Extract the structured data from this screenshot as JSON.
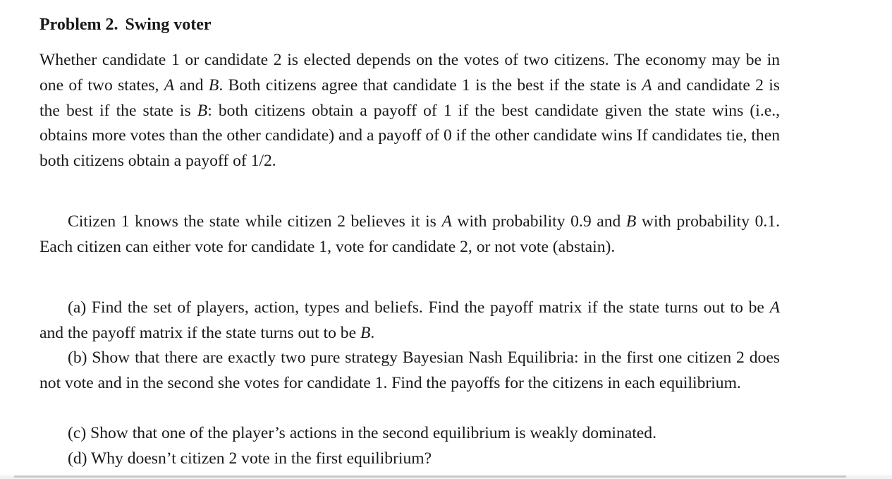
{
  "problem": {
    "label": "Problem 2.",
    "title": "Swing voter"
  },
  "paragraph1": {
    "s1": "Whether candidate 1 or candidate 2 is elected depends on the votes of two citizens. The economy may be in one of two states, ",
    "stateA": "A",
    "s2": " and ",
    "stateB": "B",
    "s3": ". Both citizens agree that candidate 1 is the best if the state is ",
    "stateA2": "A",
    "s4": " and candidate 2 is the best if the state is ",
    "stateB2": "B",
    "s5": ": both citizens obtain a payoff of 1 if the best candidate given the state wins (i.e., obtains more votes than the other candidate) and a payoff of 0 if the other candidate wins If candidates tie, then both citizens obtain a payoff of 1/2."
  },
  "paragraph2": {
    "s1": "Citizen 1 knows the state while citizen 2 believes it is ",
    "stateA": "A",
    "s2": " with probability 0.9 and ",
    "stateB": "B",
    "s3": " with probability 0.1. Each citizen can either vote for candidate 1, vote for candidate 2, or not vote (abstain)."
  },
  "questions": {
    "a": {
      "s1": "(a) Find the set of players, action, types and beliefs. Find the payoff matrix if the state turns out to be ",
      "stateA": "A",
      "s2": " and the payoff matrix if the state turns out to be ",
      "stateB": "B",
      "s3": "."
    },
    "b": "(b) Show that there are exactly two pure strategy Bayesian Nash Equilibria: in the first one citizen 2 does not vote and in the second she votes for candidate 1. Find the payoffs for the citizens in each equilibrium.",
    "c": "(c) Show that one of the player’s actions in the second equilibrium is weakly dominated.",
    "d": "(d) Why doesn’t citizen 2 vote in the first equilibrium?"
  }
}
